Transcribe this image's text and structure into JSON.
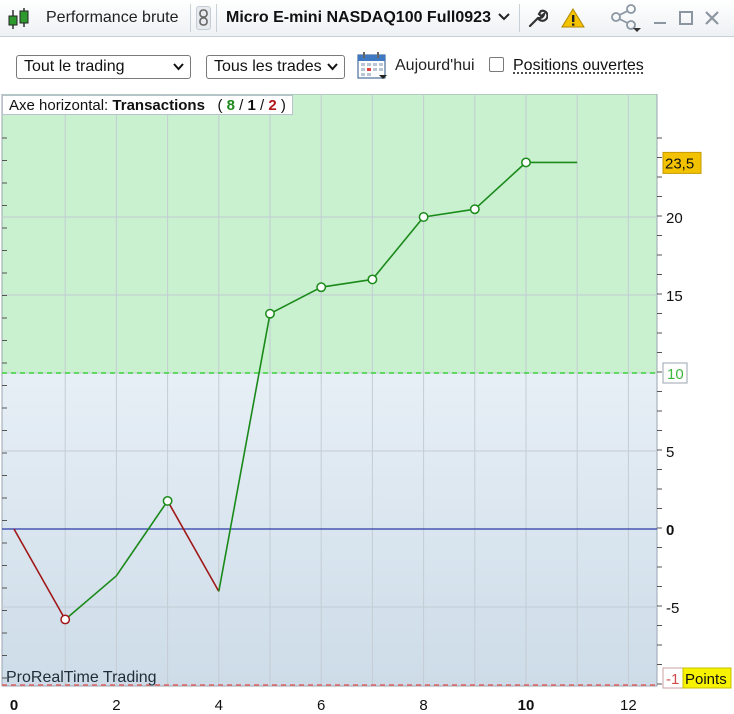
{
  "title_bar": {
    "app_title": "Performance brute",
    "instrument": "Micro E-mini NASDAQ100 Full0923",
    "icons": [
      "candlestick-icon",
      "link-icon",
      "chevron-down-icon",
      "wrench-icon",
      "warning-icon",
      "share-icon",
      "minimize-icon",
      "maximize-icon",
      "close-icon"
    ]
  },
  "toolbar": {
    "filter_select": "Tout le trading",
    "trades_select": "Tous les trades",
    "date_label": "Aujourd'hui",
    "open_positions_label": "Positions ouvertes",
    "open_positions_checked": false,
    "icons": [
      "calendar-icon"
    ]
  },
  "chart_header": {
    "axis_prefix": "Axe horizontal:",
    "axis_name": "Transactions",
    "winners": "8",
    "neutral": "1",
    "losers": "2"
  },
  "watermark": "ProRealTime Trading",
  "colors": {
    "profit_zone": "#c9f0cf",
    "loss_zone": "#d8e6ef",
    "up_line": "#1a8a1a",
    "down_line": "#a01818",
    "zero_line": "#2b3aa8",
    "threshold": "#3ccf3c",
    "last_value_badge": "#f2c200"
  },
  "chart_data": {
    "type": "line",
    "title": "",
    "xlabel": "",
    "ylabel": "Points",
    "x_ticks": [
      "0",
      "2",
      "4",
      "6",
      "8",
      "10",
      "12"
    ],
    "y_ticks": [
      "-5",
      "0",
      "5",
      "10",
      "15",
      "20"
    ],
    "xlim": [
      0,
      12.6
    ],
    "ylim": [
      -5,
      24.8
    ],
    "series": [
      {
        "x": [
          0,
          1,
          2,
          3,
          4,
          5,
          6,
          7,
          8,
          9,
          10,
          11
        ],
        "y": [
          0,
          -5.8,
          -3,
          1.8,
          -4,
          13.8,
          15.5,
          16,
          20,
          20.5,
          23.5,
          23.5
        ],
        "markers": [
          false,
          true,
          false,
          true,
          false,
          true,
          true,
          true,
          true,
          true,
          true,
          false
        ]
      }
    ],
    "zero_line": 0,
    "threshold_lines": [
      10,
      -10
    ],
    "last_value": "23,5",
    "threshold_label": "10",
    "lower_threshold_label": "-1",
    "unit_label": "Points"
  }
}
